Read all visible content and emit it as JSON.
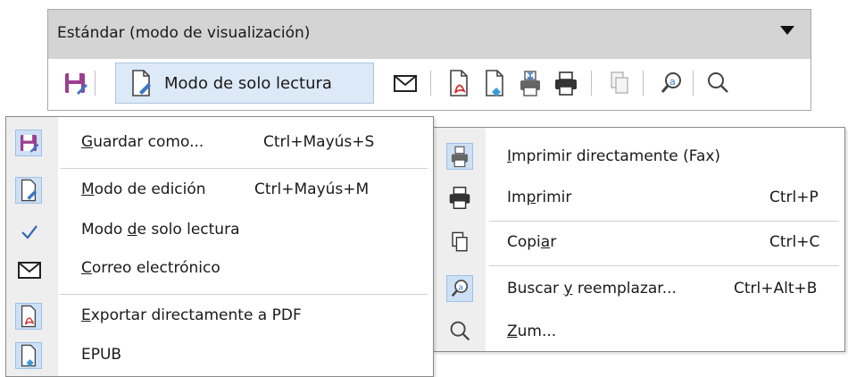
{
  "toolbar": {
    "title": "Estándar (modo de visualización)",
    "readonly_label": "Modo de solo lectura"
  },
  "menu_left": {
    "items": [
      {
        "pre": "",
        "key": "G",
        "post": "uardar como...",
        "shortcut": "Ctrl+Mayús+S",
        "icon": "save-as-icon"
      },
      {
        "pre": "",
        "key": "M",
        "post": "odo de edición",
        "shortcut": "Ctrl+Mayús+M",
        "icon": "edit-mode-icon"
      },
      {
        "pre": "Modo ",
        "key": "d",
        "post": "e solo lectura",
        "shortcut": "",
        "icon": "checkmark-icon"
      },
      {
        "pre": "",
        "key": "C",
        "post": "orreo electrónico",
        "shortcut": "",
        "icon": "envelope-icon"
      },
      {
        "pre": "",
        "key": "E",
        "post": "xportar directamente a PDF",
        "shortcut": "",
        "icon": "pdf-export-icon"
      },
      {
        "pre": "",
        "key": "",
        "post": "EPUB",
        "shortcut": "",
        "icon": "epub-icon"
      }
    ]
  },
  "menu_right": {
    "items": [
      {
        "pre": "",
        "key": "I",
        "post": "mprimir directamente (Fax)",
        "shortcut": "",
        "icon": "fax-icon"
      },
      {
        "pre": "Im",
        "key": "p",
        "post": "rimir",
        "shortcut": "Ctrl+P",
        "icon": "printer-icon"
      },
      {
        "pre": "Copi",
        "key": "a",
        "post": "r",
        "shortcut": "Ctrl+C",
        "icon": "copy-icon"
      },
      {
        "pre": "Buscar ",
        "key": "y",
        "post": " reemplazar...",
        "shortcut": "Ctrl+Alt+B",
        "icon": "find-replace-icon"
      },
      {
        "pre": "",
        "key": "Z",
        "post": "um...",
        "shortcut": "",
        "icon": "zoom-icon"
      }
    ]
  },
  "colors": {
    "accent": "#cde0f5",
    "gutter": "#eeeeee",
    "title_bar": "#d4d4d4",
    "pdf_red": "#d03030",
    "save_purple": "#9b3f8e"
  }
}
